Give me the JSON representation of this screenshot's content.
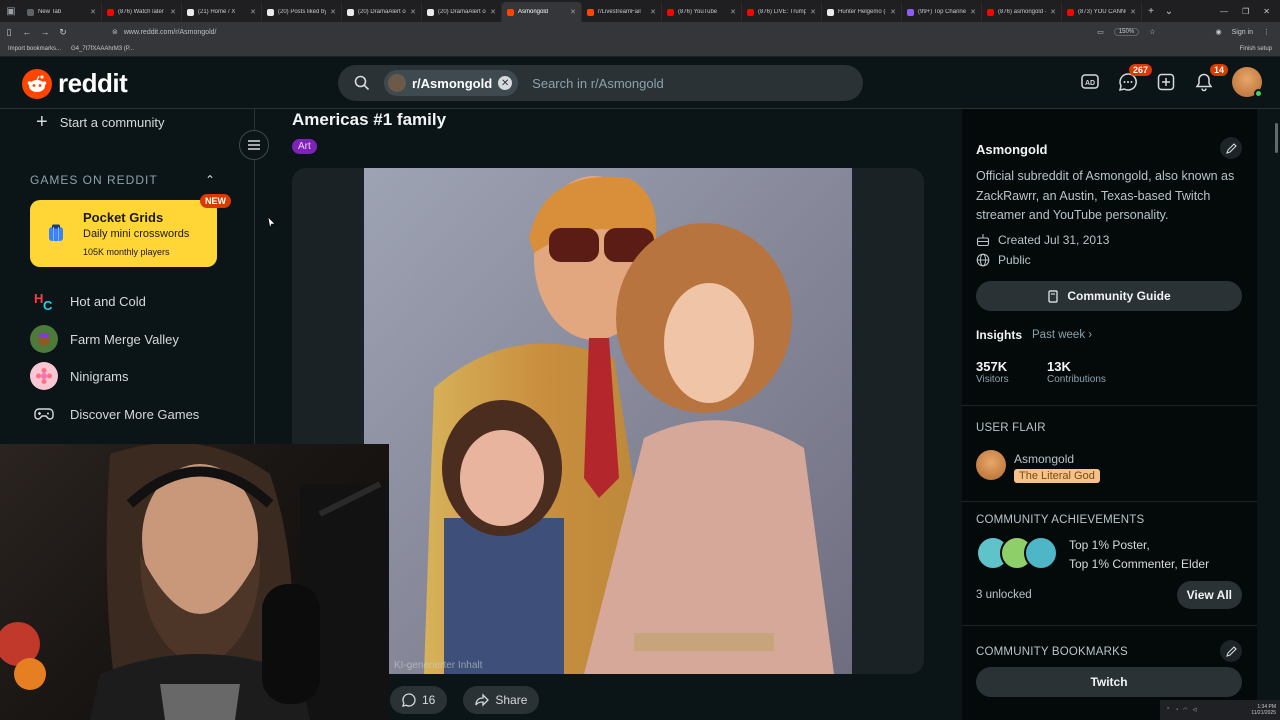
{
  "browser": {
    "tabs": [
      {
        "label": "New Tab",
        "color": "#5f6368"
      },
      {
        "label": "(876) Watch later -",
        "color": "#ff0000"
      },
      {
        "label": "(21) Home / X",
        "color": "#e8eaed"
      },
      {
        "label": "(20) Posts liked by",
        "color": "#e8eaed"
      },
      {
        "label": "(20) DramaAlert on",
        "color": "#e8eaed"
      },
      {
        "label": "(20) DramaAlert on",
        "color": "#e8eaed"
      },
      {
        "label": "Asmongold",
        "color": "#ff4500",
        "active": true
      },
      {
        "label": "r/LivestreamFail",
        "color": "#ff4500"
      },
      {
        "label": "(876) YouTube",
        "color": "#ff0000"
      },
      {
        "label": "(876) LIVE: Trump c",
        "color": "#ff0000"
      },
      {
        "label": "Hunter Helgemo (@",
        "color": "#e8eaed"
      },
      {
        "label": "(99+) Top Channel",
        "color": "#8b5cf6"
      },
      {
        "label": "(876) asmongold -",
        "color": "#ff0000"
      },
      {
        "label": "(873) YOU CANNO",
        "color": "#ff0000"
      }
    ],
    "url": "www.reddit.com/r/Asmongold/",
    "zoom": "150%",
    "sign_in": "Sign in",
    "bookmarks": [
      "Import bookmarks...",
      "G4_7t7fXAAAhrM3 (P..."
    ],
    "finish_setup": "Finish setup"
  },
  "header": {
    "logo_text": "reddit",
    "community_chip": "r/Asmongold",
    "search_placeholder": "Search in r/Asmongold",
    "chat_count": "267",
    "notif_count": "14"
  },
  "leftnav": {
    "start_community": "Start a community",
    "games_header": "GAMES ON REDDIT",
    "featured_game": {
      "title": "Pocket Grids",
      "subtitle": "Daily mini crosswords",
      "players": "105K monthly players",
      "badge": "NEW"
    },
    "games": [
      {
        "label": "Hot and Cold"
      },
      {
        "label": "Farm Merge Valley"
      },
      {
        "label": "Ninigrams"
      }
    ],
    "discover": "Discover More Games"
  },
  "post": {
    "title": "Americas #1 family",
    "flair": "Art",
    "comment_count": "16",
    "share_label": "Share",
    "watermark": "KI-generierter Inhalt"
  },
  "sidebar": {
    "name": "Asmongold",
    "description": "Official subreddit of Asmongold, also known as ZackRawrr, an Austin, Texas-based Twitch streamer and YouTube personality.",
    "created": "Created Jul 31, 2013",
    "visibility": "Public",
    "guide_label": "Community Guide",
    "insights_label": "Insights",
    "insights_range": "Past week",
    "visitors_num": "357K",
    "visitors_label": "Visitors",
    "contrib_num": "13K",
    "contrib_label": "Contributions",
    "user_flair_hdr": "USER FLAIR",
    "user_name": "Asmongold",
    "user_flair": "The Literal God",
    "achievements_hdr": "COMMUNITY ACHIEVEMENTS",
    "ach_line1": "Top 1% Poster,",
    "ach_line2": "Top 1% Commenter, Elder",
    "unlocked": "3 unlocked",
    "view_all": "View All",
    "bookmarks_hdr": "COMMUNITY BOOKMARKS",
    "bookmark_item": "Twitch"
  },
  "taskbar": {
    "time": "1:34 PM",
    "date": "11/21/2025"
  }
}
